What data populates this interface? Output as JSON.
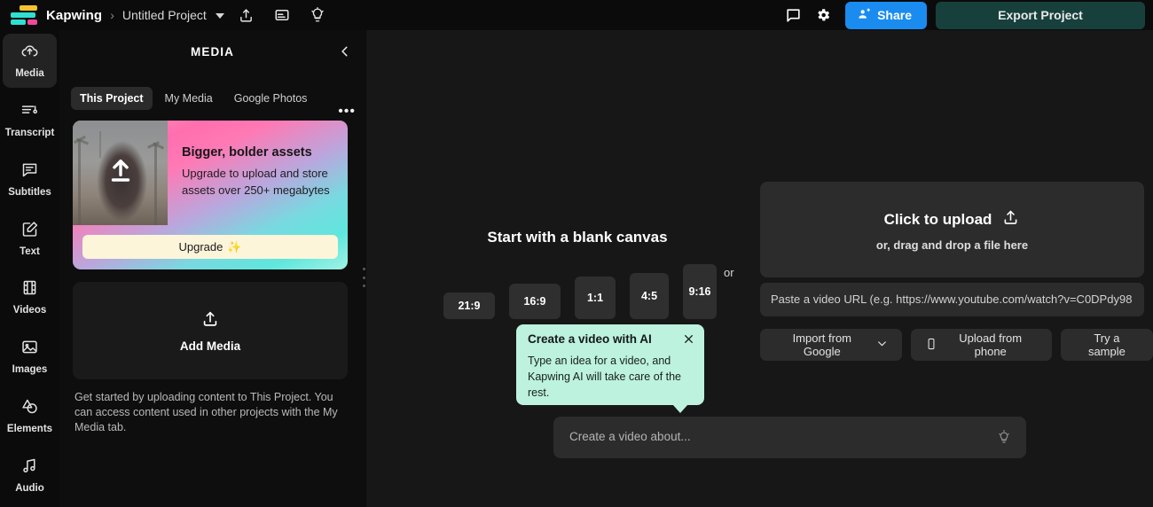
{
  "topbar": {
    "brand": "Kapwing",
    "separator": "›",
    "project_name": "Untitled Project",
    "icons": [
      "share-upload-icon",
      "subtitles-icon",
      "lightbulb-icon"
    ],
    "comment_icon": "comment-icon",
    "settings_icon": "gear-icon",
    "share_label": "Share",
    "export_label": "Export Project",
    "share_color": "#1a8cf0",
    "export_color": "#17403c"
  },
  "rail": {
    "items": [
      {
        "label": "Media",
        "icon": "cloud-upload-icon",
        "active": true
      },
      {
        "label": "Transcript",
        "icon": "transcript-icon",
        "active": false
      },
      {
        "label": "Subtitles",
        "icon": "subtitles-icon",
        "active": false
      },
      {
        "label": "Text",
        "icon": "text-edit-icon",
        "active": false
      },
      {
        "label": "Videos",
        "icon": "film-strip-icon",
        "active": false
      },
      {
        "label": "Images",
        "icon": "image-icon",
        "active": false
      },
      {
        "label": "Elements",
        "icon": "shapes-icon",
        "active": false
      },
      {
        "label": "Audio",
        "icon": "music-note-icon",
        "active": false
      }
    ]
  },
  "panel": {
    "title": "MEDIA",
    "collapse_icon": "chevron-left-icon",
    "more_icon": "more-horizontal-icon",
    "tabs": [
      {
        "label": "This Project",
        "active": true
      },
      {
        "label": "My Media",
        "active": false
      },
      {
        "label": "Google Photos",
        "active": false
      }
    ],
    "promo": {
      "title": "Bigger, bolder assets",
      "subtitle": "Upgrade to upload and store assets over 250+ megabytes",
      "button_label": "Upgrade",
      "button_sparkle": "✨",
      "thumb_icon": "upload-arrow-icon"
    },
    "add_media": {
      "label": "Add Media",
      "icon": "upload-icon"
    },
    "note": "Get started by uploading content to This Project. You can access content used in other projects with the My Media tab."
  },
  "stage": {
    "blank_title": "Start with a blank canvas",
    "ratios": [
      {
        "label": "21:9"
      },
      {
        "label": "16:9"
      },
      {
        "label": "1:1"
      },
      {
        "label": "4:5"
      },
      {
        "label": "9:16"
      }
    ],
    "or_label": "or",
    "tooltip": {
      "title": "Create a video with AI",
      "body": "Type an idea for a video, and Kapwing AI will take care of the rest.",
      "close_icon": "close-icon",
      "background": "#bdf2de"
    },
    "ai_input": {
      "placeholder": "Create a video about...",
      "icon": "lightbulb-icon"
    },
    "upload": {
      "title": "Click to upload",
      "title_icon": "upload-icon",
      "subtitle": "or, drag and drop a file here",
      "url_placeholder": "Paste a video URL (e.g. https://www.youtube.com/watch?v=C0DPdy98",
      "buttons": [
        {
          "label": "Import from Google",
          "icon": "chevron-down-icon",
          "icon_pos": "after"
        },
        {
          "label": "Upload from phone",
          "icon": "phone-icon",
          "icon_pos": "before"
        },
        {
          "label": "Try a sample",
          "icon": "",
          "icon_pos": "none"
        }
      ]
    }
  }
}
